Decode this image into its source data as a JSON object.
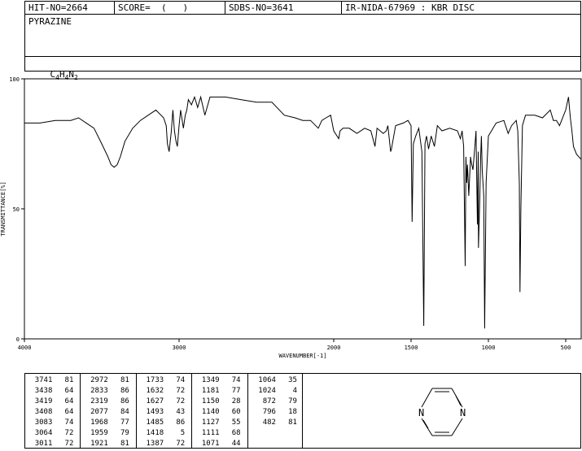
{
  "header": {
    "hit_no": "HIT-NO=2664",
    "score": "SCORE=  (   )",
    "sdbs_no": "SDBS-NO=3641",
    "ir_info": "IR-NIDA-67969 : KBR DISC",
    "compound_name": "PYRAZINE",
    "formula_parts": [
      "C",
      "4",
      "H",
      "4",
      "N",
      "2"
    ]
  },
  "chart_data": {
    "type": "line",
    "xlabel": "WAVENUMBER[-1]",
    "ylabel": "TRANSMITTANCE[%]",
    "xlim": [
      4000,
      400
    ],
    "ylim": [
      0,
      100
    ],
    "xticks": [
      4000,
      3000,
      2000,
      1500,
      1000,
      500
    ],
    "yticks": [
      0,
      50,
      100
    ],
    "grid": false,
    "series": [
      {
        "x": [
          4000,
          3900,
          3800,
          3700,
          3650,
          3600,
          3550,
          3500,
          3460,
          3440,
          3420,
          3400,
          3380,
          3350,
          3300,
          3250,
          3200,
          3150,
          3100,
          3083,
          3075,
          3064,
          3050,
          3040,
          3030,
          3020,
          3011,
          3000,
          2990,
          2972,
          2960,
          2950,
          2940,
          2920,
          2900,
          2880,
          2860,
          2833,
          2800,
          2750,
          2700,
          2600,
          2500,
          2400,
          2319,
          2250,
          2200,
          2150,
          2100,
          2077,
          2050,
          2020,
          2000,
          1968,
          1959,
          1940,
          1921,
          1900,
          1850,
          1800,
          1760,
          1733,
          1720,
          1700,
          1680,
          1660,
          1650,
          1632,
          1627,
          1600,
          1550,
          1520,
          1500,
          1493,
          1485,
          1470,
          1450,
          1430,
          1418,
          1410,
          1400,
          1387,
          1370,
          1349,
          1330,
          1300,
          1250,
          1200,
          1181,
          1170,
          1160,
          1150,
          1145,
          1140,
          1135,
          1127,
          1115,
          1111,
          1100,
          1090,
          1080,
          1071,
          1066,
          1064,
          1055,
          1050,
          1045,
          1040,
          1030,
          1024,
          1015,
          1000,
          950,
          900,
          872,
          850,
          820,
          810,
          800,
          796,
          790,
          780,
          760,
          700,
          650,
          600,
          580,
          560,
          540,
          500,
          482,
          470,
          460,
          450,
          430,
          400
        ],
        "y": [
          83,
          83,
          84,
          84,
          85,
          83,
          81,
          75,
          70,
          67,
          66,
          67,
          70,
          76,
          81,
          84,
          86,
          88,
          85,
          82,
          75,
          72,
          80,
          88,
          80,
          76,
          74,
          82,
          88,
          81,
          86,
          88,
          92,
          90,
          93,
          89,
          93,
          86,
          93,
          93,
          93,
          92,
          91,
          91,
          86,
          85,
          84,
          84,
          81,
          84,
          85,
          86,
          80,
          77,
          80,
          81,
          81,
          81,
          79,
          81,
          80,
          74,
          81,
          80,
          79,
          80,
          82,
          72,
          73,
          82,
          83,
          84,
          82,
          45,
          75,
          78,
          81,
          72,
          5,
          75,
          78,
          73,
          78,
          74,
          82,
          80,
          81,
          80,
          77,
          80,
          74,
          28,
          70,
          60,
          67,
          55,
          70,
          68,
          65,
          72,
          80,
          44,
          72,
          35,
          55,
          70,
          78,
          65,
          55,
          4,
          60,
          78,
          83,
          84,
          79,
          82,
          84,
          80,
          60,
          18,
          50,
          82,
          86,
          86,
          85,
          88,
          84,
          84,
          82,
          88,
          93,
          85,
          80,
          74,
          71,
          69
        ]
      }
    ]
  },
  "peaks_table": {
    "columns": [
      [
        [
          "3741",
          "81"
        ],
        [
          "3438",
          "64"
        ],
        [
          "3419",
          "64"
        ],
        [
          "3408",
          "64"
        ],
        [
          "3083",
          "74"
        ],
        [
          "3064",
          "72"
        ],
        [
          "3011",
          "72"
        ]
      ],
      [
        [
          "2972",
          "81"
        ],
        [
          "2833",
          "86"
        ],
        [
          "2319",
          "86"
        ],
        [
          "2077",
          "84"
        ],
        [
          "1968",
          "77"
        ],
        [
          "1959",
          "79"
        ],
        [
          "1921",
          "81"
        ]
      ],
      [
        [
          "1733",
          "74"
        ],
        [
          "1632",
          "72"
        ],
        [
          "1627",
          "72"
        ],
        [
          "1493",
          "43"
        ],
        [
          "1485",
          "86"
        ],
        [
          "1418",
          "5"
        ],
        [
          "1387",
          "72"
        ]
      ],
      [
        [
          "1349",
          "74"
        ],
        [
          "1181",
          "77"
        ],
        [
          "1150",
          "28"
        ],
        [
          "1140",
          "60"
        ],
        [
          "1127",
          "55"
        ],
        [
          "1111",
          "68"
        ],
        [
          "1071",
          "44"
        ]
      ],
      [
        [
          "1064",
          "35"
        ],
        [
          "1024",
          "4"
        ],
        [
          "872",
          "79"
        ],
        [
          "796",
          "18"
        ],
        [
          "482",
          "81"
        ]
      ]
    ]
  },
  "structure": {
    "atom_labels": [
      "N",
      "N"
    ]
  }
}
